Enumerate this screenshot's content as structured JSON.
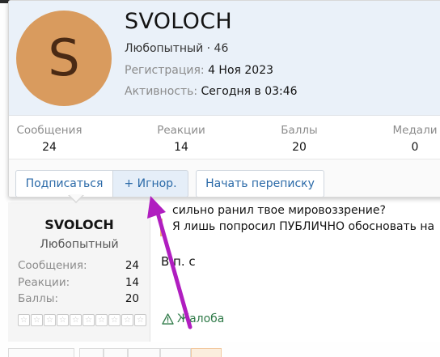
{
  "card": {
    "avatar_letter": "S",
    "username": "SVOLOCH",
    "title_line": "Любопытный · 46",
    "registration_label": "Регистрация:",
    "registration_value": "4 Ноя 2023",
    "activity_label": "Активность:",
    "activity_value": "Сегодня в 03:46",
    "stats": [
      {
        "label": "Сообщения",
        "value": "24"
      },
      {
        "label": "Реакции",
        "value": "14"
      },
      {
        "label": "Баллы",
        "value": "20"
      },
      {
        "label": "Медали",
        "value": "0"
      }
    ],
    "buttons": {
      "follow": "Подписаться",
      "ignore": "+ Игнор.",
      "message": "Начать переписку"
    }
  },
  "post": {
    "author": "SVOLOCH",
    "author_title": "Любопытный",
    "stats": [
      {
        "label": "Сообщения:",
        "value": "24"
      },
      {
        "label": "Реакции:",
        "value": "14"
      },
      {
        "label": "Баллы:",
        "value": "20"
      }
    ],
    "quote_line1": "сильно ранил твое мировоззрение?",
    "quote_line2": "Я лишь попросил ПУБЛИЧНО обосновать на",
    "body": "В п. с",
    "report_label": "Жалоба"
  },
  "colors": {
    "avatar_bg": "#d99b5e",
    "card_header_bg": "#eaf1f9",
    "link": "#2b6aa8",
    "annotation_arrow": "#b01ec0",
    "report_green": "#2f7a48"
  },
  "icons": {
    "report": "warning-triangle-icon",
    "annotation": "arrow-annotation"
  }
}
